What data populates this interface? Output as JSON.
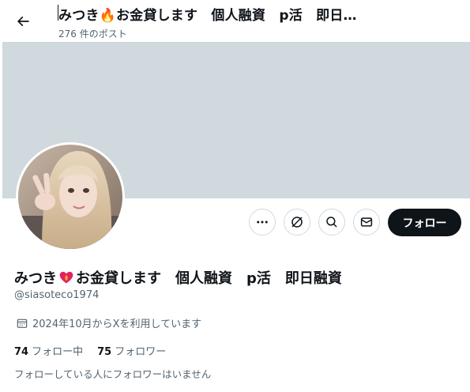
{
  "header": {
    "title": "みつき🔥お金貸します　個人融資　p活　即日…",
    "post_count": "276 件のポスト"
  },
  "profile": {
    "name_part1": "みつき",
    "name_part2": "お金貸します　個人融資　p活　即日融資",
    "handle": "@siasoteco1974",
    "joined": "2024年10月からXを利用しています",
    "following_count": "74",
    "following_label": "フォロー中",
    "followers_count": "75",
    "followers_label": "フォロワー",
    "followers_note": "フォローしている人にフォロワーはいません"
  },
  "actions": {
    "follow_label": "フォロー",
    "icons": [
      "more-icon",
      "grok-icon",
      "search-icon",
      "message-icon"
    ]
  },
  "colors": {
    "banner": "#cfd9de",
    "text_primary": "#0f1419",
    "text_secondary": "#536471",
    "follow_bg": "#0f1419"
  }
}
